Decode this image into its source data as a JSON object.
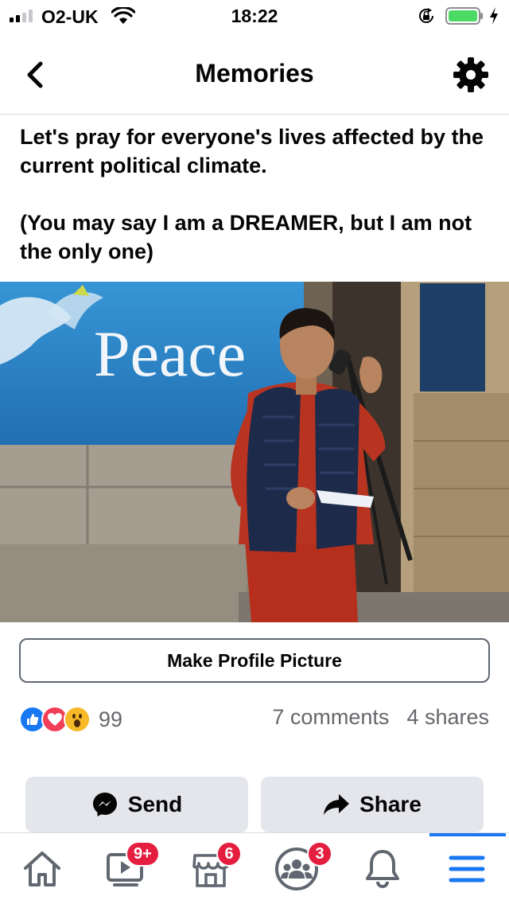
{
  "status_bar": {
    "carrier": "O2-UK",
    "time": "18:22"
  },
  "header": {
    "title": "Memories",
    "back_icon": "chevron-left-icon",
    "settings_icon": "gear-icon"
  },
  "post": {
    "text": "Let's pray for everyone's lives affected by the current political climate.\n\n(You may say I am a DREAMER, but I am not the only one)",
    "photo_banner_text": "Peace",
    "make_profile_label": "Make Profile Picture",
    "reactions": [
      "like",
      "love",
      "wow"
    ],
    "reaction_count": "99",
    "comments": "7 comments",
    "shares": "4 shares"
  },
  "actions": {
    "send_label": "Send",
    "share_label": "Share"
  },
  "tabs": [
    {
      "name": "home",
      "icon": "home-icon",
      "badge": ""
    },
    {
      "name": "watch",
      "icon": "video-icon",
      "badge": "9+"
    },
    {
      "name": "marketplace",
      "icon": "store-icon",
      "badge": "6"
    },
    {
      "name": "groups",
      "icon": "groups-icon",
      "badge": "3"
    },
    {
      "name": "notifications",
      "icon": "bell-icon",
      "badge": ""
    },
    {
      "name": "menu",
      "icon": "menu-icon",
      "badge": "",
      "active": true
    }
  ],
  "colors": {
    "accent": "#1877f2",
    "badge": "#e41e3f",
    "button_bg": "#e4e6eb",
    "muted_text": "#65676b"
  }
}
